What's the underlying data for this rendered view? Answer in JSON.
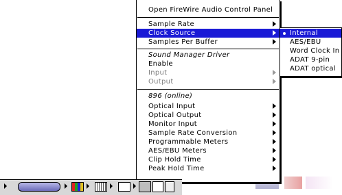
{
  "main_menu": {
    "items": [
      {
        "label": "Open FireWire Audio Control Panel"
      },
      {
        "label": "Sample Rate"
      },
      {
        "label": "Clock Source"
      },
      {
        "label": "Samples Per Buffer"
      },
      {
        "label": "Sound Manager Driver"
      },
      {
        "label": "Enable"
      },
      {
        "label": "Input"
      },
      {
        "label": "Output"
      },
      {
        "label": "896 (online)"
      },
      {
        "label": "Optical Input"
      },
      {
        "label": "Optical Output"
      },
      {
        "label": "Monitor Input"
      },
      {
        "label": "Sample Rate Conversion"
      },
      {
        "label": "Programmable Meters"
      },
      {
        "label": "AES/EBU Meters"
      },
      {
        "label": "Clip Hold Time"
      },
      {
        "label": "Peak Hold Time"
      }
    ]
  },
  "clock_source_submenu": {
    "items": [
      {
        "label": "Internal",
        "selected": true
      },
      {
        "label": "AES/EBU"
      },
      {
        "label": "Word Clock In"
      },
      {
        "label": "ADAT 9-pin"
      },
      {
        "label": "ADAT optical"
      }
    ]
  },
  "colors": {
    "highlight": "#1a1ad6",
    "strip": "#d8d8d8"
  },
  "control_strip": {
    "icons": [
      "speaker-icon",
      "monitor-color-icon",
      "resolution-icon",
      "file-sharing-icon",
      "appletalk-icon",
      "cd-icon"
    ]
  }
}
